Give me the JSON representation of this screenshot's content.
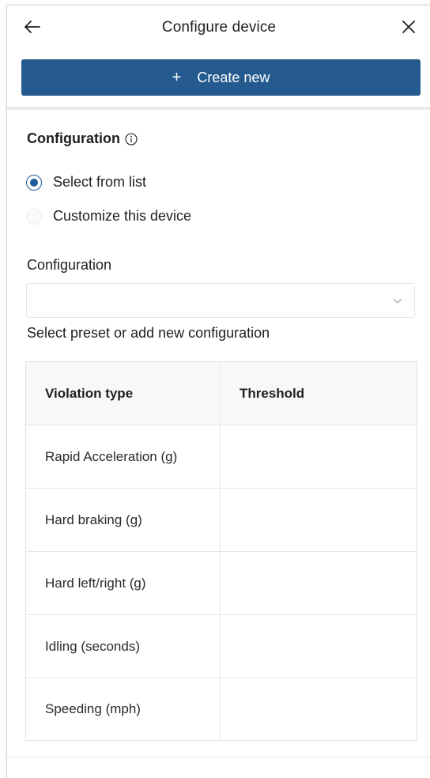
{
  "header": {
    "title": "Configure device",
    "back_icon": "arrow-left-icon",
    "close_icon": "close-icon"
  },
  "toolbar": {
    "create_plus": "+",
    "create_label": "Create new",
    "accent_color": "#245a8e"
  },
  "configuration": {
    "section_title": "Configuration",
    "info_icon": "info-icon",
    "options": [
      {
        "label": "Select from list",
        "checked": true
      },
      {
        "label": "Customize this device",
        "checked": false
      }
    ],
    "field_label": "Configuration",
    "select_value": "",
    "helper_text": "Select preset or add new configuration"
  },
  "table": {
    "headers": [
      "Violation type",
      "Threshold"
    ],
    "rows": [
      {
        "violation": "Rapid Acceleration (g)",
        "threshold": ""
      },
      {
        "violation": "Hard braking (g)",
        "threshold": ""
      },
      {
        "violation": "Hard left/right (g)",
        "threshold": ""
      },
      {
        "violation": "Idling (seconds)",
        "threshold": ""
      },
      {
        "violation": "Speeding (mph)",
        "threshold": ""
      }
    ]
  }
}
